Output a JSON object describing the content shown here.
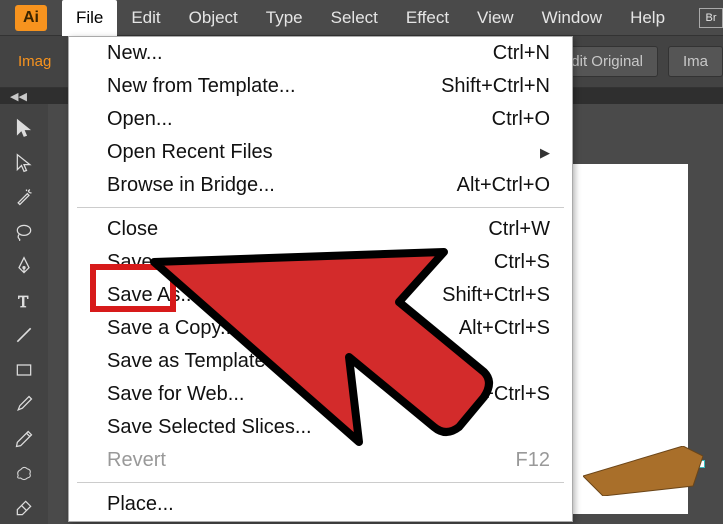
{
  "app": {
    "icon_label": "Ai"
  },
  "menubar": {
    "items": [
      "File",
      "Edit",
      "Object",
      "Type",
      "Select",
      "Effect",
      "View",
      "Window",
      "Help"
    ],
    "active_index": 0,
    "br_label": "Br"
  },
  "options": {
    "left_label": "Imag",
    "edit_original": "dit Original",
    "image": "Ima"
  },
  "collapse_chevron": "◀◀",
  "file_menu": {
    "groups": [
      [
        {
          "label": "New...",
          "shortcut": "Ctrl+N",
          "disabled": false
        },
        {
          "label": "New from Template...",
          "shortcut": "Shift+Ctrl+N",
          "disabled": false
        },
        {
          "label": "Open...",
          "shortcut": "Ctrl+O",
          "disabled": false
        },
        {
          "label": "Open Recent Files",
          "shortcut": "",
          "submenu": true,
          "disabled": false
        },
        {
          "label": "Browse in Bridge...",
          "shortcut": "Alt+Ctrl+O",
          "disabled": false
        }
      ],
      [
        {
          "label": "Close",
          "shortcut": "Ctrl+W",
          "disabled": false
        },
        {
          "label": "Save",
          "shortcut": "Ctrl+S",
          "disabled": false
        },
        {
          "label": "Save As...",
          "shortcut": "Shift+Ctrl+S",
          "disabled": false
        },
        {
          "label": "Save a Copy...",
          "shortcut": "Alt+Ctrl+S",
          "disabled": false
        },
        {
          "label": "Save as Template...",
          "shortcut": "",
          "disabled": false
        },
        {
          "label": "Save for Web...",
          "shortcut": "Alt+Shift+Ctrl+S",
          "disabled": false
        },
        {
          "label": "Save Selected Slices...",
          "shortcut": "",
          "disabled": false
        },
        {
          "label": "Revert",
          "shortcut": "F12",
          "disabled": true
        }
      ],
      [
        {
          "label": "Place...",
          "shortcut": "",
          "disabled": false
        }
      ]
    ]
  },
  "tools": [
    "selection",
    "direct-selection",
    "magic-wand",
    "lasso",
    "pen",
    "type",
    "line-segment",
    "rectangle",
    "paintbrush",
    "pencil",
    "blob-brush",
    "eraser"
  ]
}
